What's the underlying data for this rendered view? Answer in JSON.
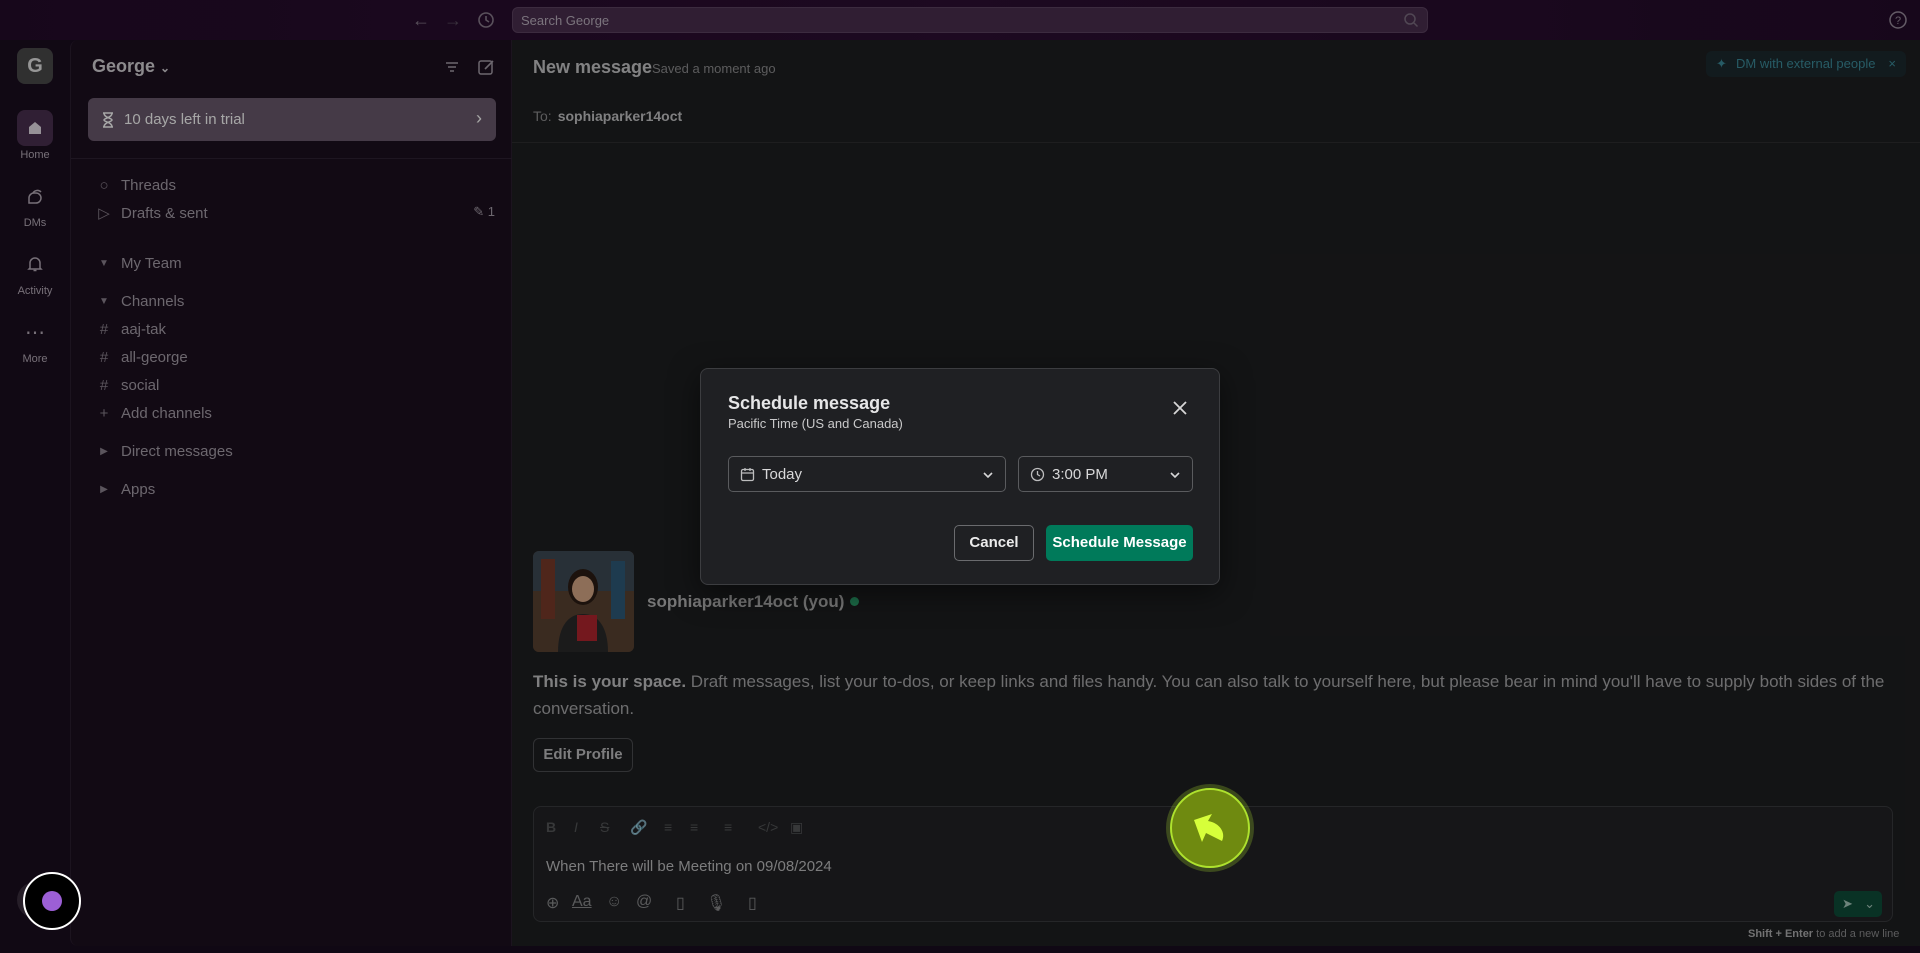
{
  "topbar": {
    "search_placeholder": "Search George",
    "back_icon": "arrow-left-icon",
    "forward_icon": "arrow-right-icon",
    "history_icon": "clock-icon",
    "help_icon": "help-icon"
  },
  "rail": {
    "workspace_initial": "G",
    "items": [
      {
        "label": "Home",
        "icon": "home-icon"
      },
      {
        "label": "DMs",
        "icon": "dms-icon"
      },
      {
        "label": "Activity",
        "icon": "bell-icon"
      },
      {
        "label": "More",
        "icon": "ellipsis-icon"
      }
    ],
    "add_label": "+"
  },
  "sidebar": {
    "workspace_name": "George",
    "trial_text": "10 days left in trial",
    "threads": "Threads",
    "drafts": "Drafts & sent",
    "drafts_count": "1",
    "my_team": "My Team",
    "channels_header": "Channels",
    "channels": [
      "aaj-tak",
      "all-george",
      "social"
    ],
    "add_channels": "Add channels",
    "direct_messages": "Direct messages",
    "apps": "Apps"
  },
  "main": {
    "title": "New message",
    "saved": "Saved a moment ago",
    "external_chip": "DM with external people",
    "to_label": "To:",
    "to_value": "sophiaparker14oct",
    "profile_name": "sophiaparker14oct (you)",
    "intro_bold": "This is your space.",
    "intro_rest": " Draft messages, list your to-dos, or keep links and files handy. You can also talk to yourself here, but please bear in mind you'll have to supply both sides of the conversation.",
    "edit_profile": "Edit Profile",
    "composer_text": "When There will be Meeting on 09/08/2024",
    "hint_bold": "Shift + Enter",
    "hint_rest": " to add a new line"
  },
  "modal": {
    "title": "Schedule message",
    "subtitle": "Pacific Time (US and Canada)",
    "date_value": "Today",
    "time_value": "3:00 PM",
    "cancel": "Cancel",
    "schedule": "Schedule Message"
  },
  "colors": {
    "accent_green": "#007a5a",
    "trial_bg": "#6a5a6d",
    "cursor_ring": "#aee22e"
  }
}
